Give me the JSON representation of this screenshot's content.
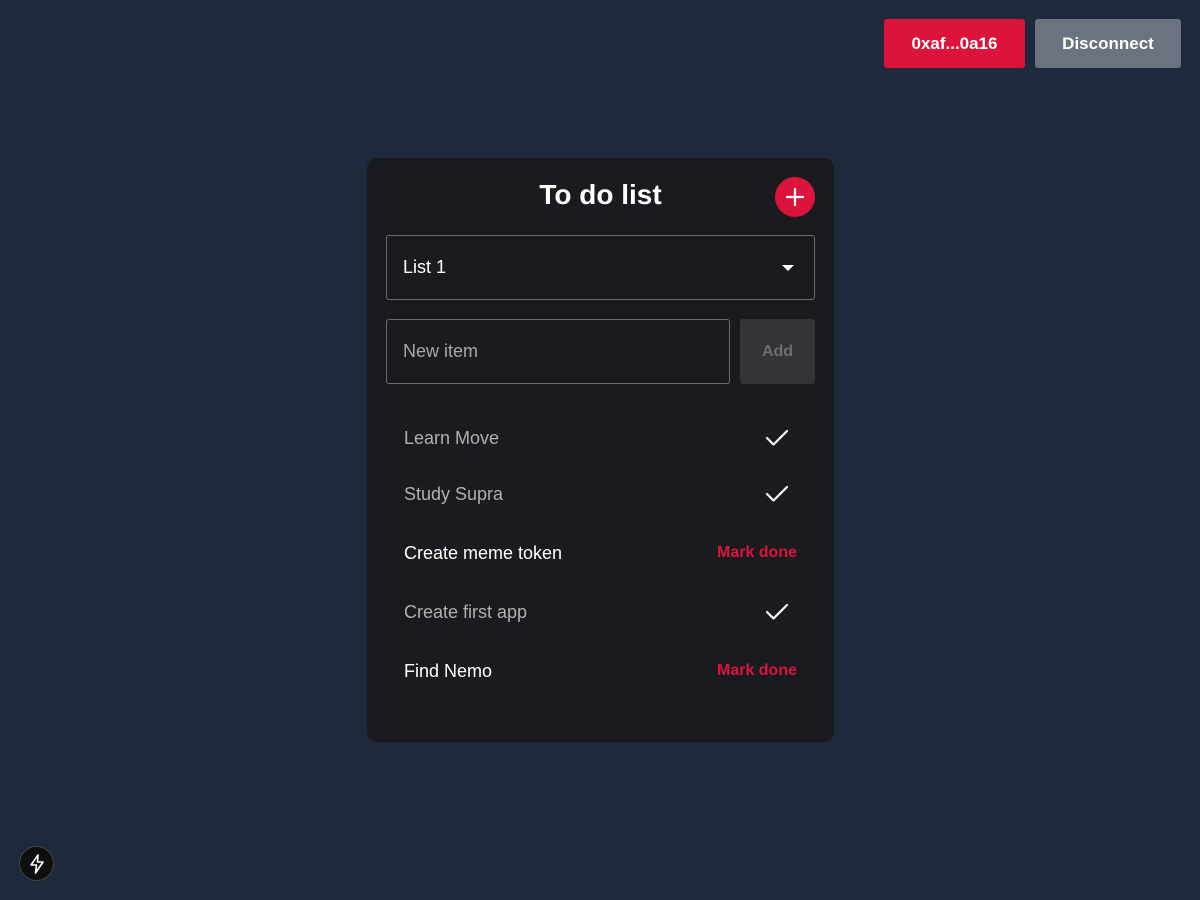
{
  "header": {
    "wallet_label": "0xaf...0a16",
    "disconnect_label": "Disconnect"
  },
  "card": {
    "title": "To do list",
    "add_list_icon": "plus-icon",
    "list_select": {
      "value": "List 1"
    },
    "new_item": {
      "placeholder": "New item",
      "value": "",
      "add_label": "Add"
    },
    "items": [
      {
        "label": "Learn Move",
        "done": true
      },
      {
        "label": "Study Supra",
        "done": true
      },
      {
        "label": "Create meme token",
        "done": false,
        "action_label": "Mark done"
      },
      {
        "label": "Create first app",
        "done": true
      },
      {
        "label": "Find Nemo",
        "done": false,
        "action_label": "Mark done"
      }
    ]
  },
  "badge": {
    "icon": "lightning-icon"
  },
  "colors": {
    "accent": "#dc143c",
    "background": "#1e293b",
    "card": "#1a1b1e",
    "secondary_button": "#6b7280"
  }
}
